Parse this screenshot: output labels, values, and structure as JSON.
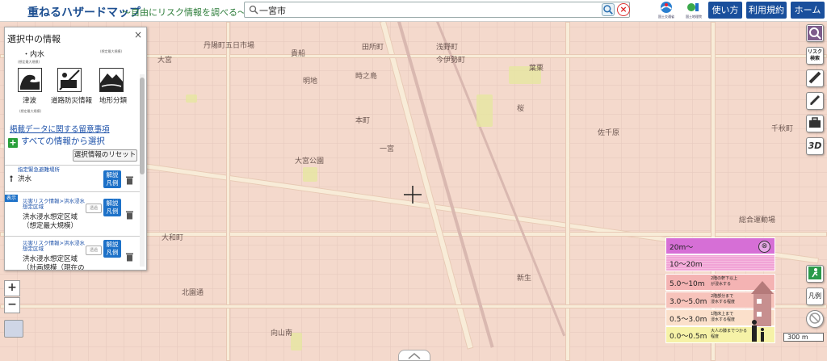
{
  "header": {
    "title": "重ねるハザードマップ",
    "subtitle": "〜自由にリスク情報を調べる〜",
    "search_value": "一宮市",
    "org1": "国土交通省",
    "org2": "国土地理院",
    "buttons": [
      "使い方",
      "利用規約",
      "ホーム"
    ]
  },
  "panel": {
    "title": "選択中の情報",
    "close": "×",
    "inner_water": "・内水",
    "inner_note": "(想定最大規模)",
    "inner_note2": "(想定最大規模)",
    "layers": [
      "津波",
      "道路防災情報",
      "地形分類"
    ],
    "tsunami_note": "(想定最大規模)",
    "caution_link": "掲載データに関する留意事項",
    "all_info": "すべての情報から選択",
    "reset": "選択情報のリセット",
    "badge": "表示",
    "rows": [
      {
        "category": "指定緊急避難場所",
        "name": "洪水",
        "btn": "解説\n凡例"
      },
      {
        "category": "災害リスク情報>洪水浸水想定区域",
        "name": "洪水浸水想定区域\n（想定最大規模）",
        "btn": "解説\n凡例",
        "tomei": "透過"
      },
      {
        "category": "災害リスク情報>洪水浸水想定区域",
        "name": "洪水浸水想定区域\n（計画規模（現在の",
        "btn": "解説\n凡例",
        "tomei": "透過"
      }
    ]
  },
  "legend": {
    "rows": [
      {
        "value": "20m〜",
        "desc": "",
        "color": "#d66fd6"
      },
      {
        "value": "10〜20m",
        "desc": "",
        "color": "#f1a3d6"
      },
      {
        "value": "5.0〜10m",
        "desc": "2階の軒下以上\nが浸水する",
        "color": "#f4b3b3"
      },
      {
        "value": "3.0〜5.0m",
        "desc": "2階部分まで\n浸水する程度",
        "color": "#f7c3bb"
      },
      {
        "value": "0.5〜3.0m",
        "desc": "1階床上まで\n浸水する程度",
        "color": "#fbe0cb"
      },
      {
        "value": "0.0〜0.5m",
        "desc": "大人の膝までつかる程度",
        "color": "#f6f2a7"
      }
    ],
    "close": "⊗"
  },
  "scale": "300 m",
  "map_labels": [
    "丹陽町五日市場",
    "貴船",
    "田所町",
    "明地",
    "浅野町",
    "葉栗",
    "一宮",
    "佐千原",
    "大宮",
    "時之島",
    "今伊勢町",
    "千秋町",
    "桜",
    "大和町",
    "総合運動場",
    "北園通",
    "向山南",
    "本町",
    "大宮公園",
    "新生"
  ],
  "tools": [
    "search-hazard",
    "risk-search",
    "draw-line",
    "pen",
    "toolbox",
    "3d"
  ],
  "tool_labels": {
    "risk": "リスク\n検索",
    "threeD": "3D",
    "legend": "凡例"
  },
  "zoom": {
    "in": "+",
    "out": "−"
  }
}
